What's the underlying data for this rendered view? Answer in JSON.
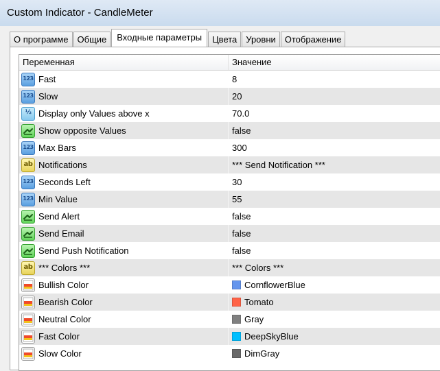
{
  "window": {
    "title": "Custom Indicator - CandleMeter"
  },
  "tabs": [
    {
      "label": "О программе",
      "active": false
    },
    {
      "label": "Общие",
      "active": false
    },
    {
      "label": "Входные параметры",
      "active": true
    },
    {
      "label": "Цвета",
      "active": false
    },
    {
      "label": "Уровни",
      "active": false
    },
    {
      "label": "Отображение",
      "active": false
    }
  ],
  "grid": {
    "headers": {
      "variable": "Переменная",
      "value": "Значение"
    },
    "rows": [
      {
        "name": "Fast",
        "value": "8",
        "type": "int",
        "icon": "integer-icon"
      },
      {
        "name": "Slow",
        "value": "20",
        "type": "int",
        "icon": "integer-icon"
      },
      {
        "name": "Display only Values above x",
        "value": "70.0",
        "type": "double",
        "icon": "double-icon"
      },
      {
        "name": "Show opposite Values",
        "value": "false",
        "type": "bool",
        "icon": "bool-icon"
      },
      {
        "name": "Max Bars",
        "value": "300",
        "type": "int",
        "icon": "integer-icon"
      },
      {
        "name": "Notifications",
        "value": "*** Send Notification ***",
        "type": "string",
        "icon": "string-icon"
      },
      {
        "name": "Seconds Left",
        "value": "30",
        "type": "int",
        "icon": "integer-icon"
      },
      {
        "name": "Min Value",
        "value": "55",
        "type": "int",
        "icon": "integer-icon"
      },
      {
        "name": "Send Alert",
        "value": "false",
        "type": "bool",
        "icon": "bool-icon"
      },
      {
        "name": "Send Email",
        "value": "false",
        "type": "bool",
        "icon": "bool-icon"
      },
      {
        "name": "Send Push Notification",
        "value": "false",
        "type": "bool",
        "icon": "bool-icon"
      },
      {
        "name": "*** Colors ***",
        "value": "*** Colors ***",
        "type": "string",
        "icon": "string-icon"
      },
      {
        "name": "Bullish Color",
        "value": "CornflowerBlue",
        "type": "color",
        "icon": "color-icon",
        "swatch": "#6495ed"
      },
      {
        "name": "Bearish Color",
        "value": "Tomato",
        "type": "color",
        "icon": "color-icon",
        "swatch": "#ff6347"
      },
      {
        "name": "Neutral Color",
        "value": "Gray",
        "type": "color",
        "icon": "color-icon",
        "swatch": "#808080"
      },
      {
        "name": "Fast Color",
        "value": "DeepSkyBlue",
        "type": "color",
        "icon": "color-icon",
        "swatch": "#00bfff"
      },
      {
        "name": "Slow Color",
        "value": "DimGray",
        "type": "color",
        "icon": "color-icon",
        "swatch": "#696969"
      }
    ]
  },
  "icon_labels": {
    "int": "123",
    "double": "½",
    "string": "ab"
  },
  "colors": {
    "row_alt": "#e6e6e6",
    "icon_int": "#5a9fe0",
    "icon_bool": "#61d35a",
    "icon_string": "#e8d35a",
    "icon_color_fill_top": "#f04a2a",
    "icon_color_fill_bottom": "#f2c21d"
  }
}
